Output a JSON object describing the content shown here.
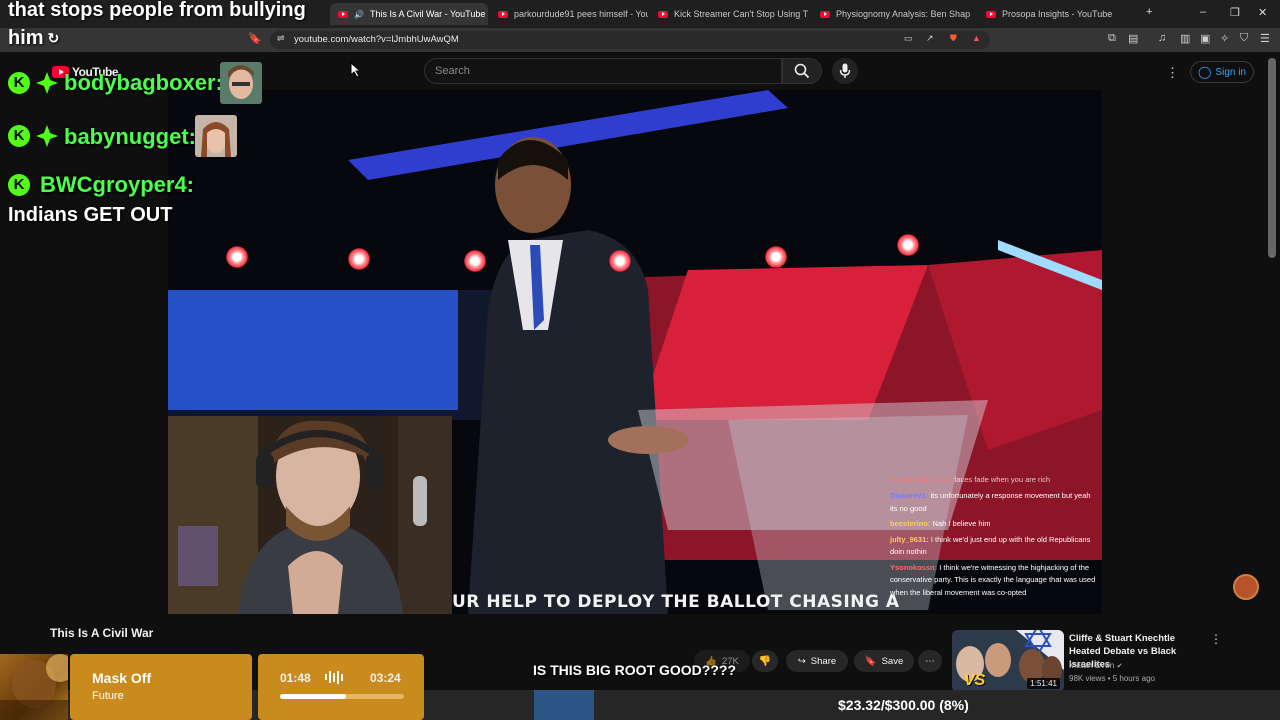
{
  "overlay_top": {
    "line1": "that stops people from bullying",
    "line2": "him"
  },
  "browser": {
    "tabs": [
      {
        "label": "This Is A Civil War - YouTube",
        "active": true
      },
      {
        "label": "parkourdude91 pees himself - YouT",
        "active": false
      },
      {
        "label": "Kick Streamer Can't Stop Using The",
        "active": false
      },
      {
        "label": "Physiognomy Analysis: Ben Shapiro",
        "active": false
      },
      {
        "label": "Prosopa Insights - YouTube",
        "active": false
      }
    ],
    "url": "youtube.com/watch?v=lJmbhUwAwQM"
  },
  "youtube": {
    "logo": "YouTube",
    "search_placeholder": "Search",
    "sign_in": "Sign in",
    "video_title": "This Is A Civil War",
    "caption": "UR HELP TO DEPLOY THE BALLOT CHASING A",
    "like_count": "27K",
    "share": "Share",
    "save": "Save"
  },
  "overlay_chat": [
    {
      "user": "bodybagboxer:",
      "message": ""
    },
    {
      "user": "babynugget:",
      "message": ""
    },
    {
      "user": "BWCgroyper4:",
      "message": "Indians GET OUT"
    }
  ],
  "stream_chat": [
    {
      "user": "legendram_pexo:",
      "message": "faces fade when you are rich",
      "color": "#ff7a7a"
    },
    {
      "user": "Discorev1:",
      "message": "its unfortunately a response movement but yeah its no good",
      "color": "#7a7aff"
    },
    {
      "user": "becsterino:",
      "message": "Nah I believe him",
      "color": "#ffcc55"
    },
    {
      "user": "julty_9631:",
      "message": "I think we'd just end up with the old Republicans doin nothin",
      "color": "#ffcc55"
    },
    {
      "user": "Ysonokossn:",
      "message": "I think we're witnessing the highjacking of the conservative party. This is exactly the language that was used when the liberal movement was co-opted",
      "color": "#ff6a6a"
    }
  ],
  "overlay_bottom": {
    "text": "IS THIS BIG ROOT GOOD????"
  },
  "recommendation": {
    "title": "Cliffe & Stuart Knechtle Heated Debate vs Black Israelites",
    "channel": "Matan Even",
    "meta": "98K views • 5 hours ago",
    "duration": "1:51:41",
    "thumb_text": "VS"
  },
  "music": {
    "title": "Mask Off",
    "artist": "Future",
    "elapsed": "01:48",
    "total": "03:24",
    "progress": 0.53
  },
  "goal": {
    "text": "$23.32/$300.00 (8%)",
    "progress": 0.08
  },
  "colors": {
    "kick_green": "#53fc18",
    "music_gold": "#c98a1e",
    "yt_red": "#ff0033",
    "link_blue": "#3ea6ff"
  }
}
